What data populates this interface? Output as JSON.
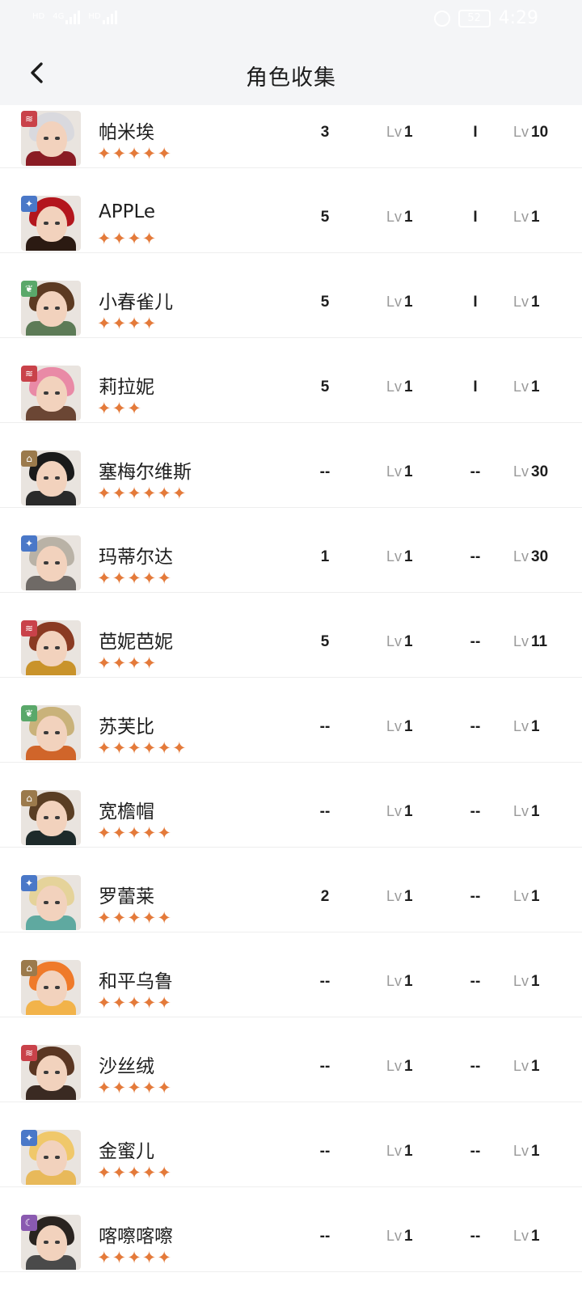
{
  "status_bar": {
    "left_tag": "HD",
    "sim1_tag": "4G",
    "sim2_tag": "HD",
    "battery": "52",
    "time": "4:29"
  },
  "header": {
    "title": "角色收集"
  },
  "characters": [
    {
      "name": "帕米埃",
      "stars": "✦✦✦✦✦",
      "col_a": "3",
      "col_b_tag": "Lv",
      "col_b": "1",
      "col_c": "I",
      "col_d_tag": "Lv",
      "col_d": "10",
      "element": "wind",
      "element_color": "#c9424a",
      "hair_color": "#d9d9de",
      "outfit_color": "#8a1c24"
    },
    {
      "name": "APPLe",
      "stars": "✦✦✦✦",
      "col_a": "5",
      "col_b_tag": "Lv",
      "col_b": "1",
      "col_c": "I",
      "col_d_tag": "Lv",
      "col_d": "1",
      "element": "star",
      "element_color": "#4a78c8",
      "hair_color": "#b3161d",
      "outfit_color": "#2b1a12"
    },
    {
      "name": "小春雀儿",
      "stars": "✦✦✦✦",
      "col_a": "5",
      "col_b_tag": "Lv",
      "col_b": "1",
      "col_c": "I",
      "col_d_tag": "Lv",
      "col_d": "1",
      "element": "leaf",
      "element_color": "#5aa86a",
      "hair_color": "#5c3a22",
      "outfit_color": "#5d7b57"
    },
    {
      "name": "莉拉妮",
      "stars": "✦✦✦",
      "col_a": "5",
      "col_b_tag": "Lv",
      "col_b": "1",
      "col_c": "I",
      "col_d_tag": "Lv",
      "col_d": "1",
      "element": "wind",
      "element_color": "#c9424a",
      "hair_color": "#e98aa6",
      "outfit_color": "#6b4634"
    },
    {
      "name": "塞梅尔维斯",
      "stars": "✦✦✦✦✦✦",
      "col_a": "--",
      "col_b_tag": "Lv",
      "col_b": "1",
      "col_c": "--",
      "col_d_tag": "Lv",
      "col_d": "30",
      "element": "rock",
      "element_color": "#9b7a4c",
      "hair_color": "#1a1a1a",
      "outfit_color": "#2a2a2a"
    },
    {
      "name": "玛蒂尔达",
      "stars": "✦✦✦✦✦",
      "col_a": "1",
      "col_b_tag": "Lv",
      "col_b": "1",
      "col_c": "--",
      "col_d_tag": "Lv",
      "col_d": "30",
      "element": "star",
      "element_color": "#4a78c8",
      "hair_color": "#b9b2a6",
      "outfit_color": "#6f6a66"
    },
    {
      "name": "芭妮芭妮",
      "stars": "✦✦✦✦",
      "col_a": "5",
      "col_b_tag": "Lv",
      "col_b": "1",
      "col_c": "--",
      "col_d_tag": "Lv",
      "col_d": "11",
      "element": "wind",
      "element_color": "#c9424a",
      "hair_color": "#8a3a22",
      "outfit_color": "#c9932b"
    },
    {
      "name": "苏芙比",
      "stars": "✦✦✦✦✦✦",
      "col_a": "--",
      "col_b_tag": "Lv",
      "col_b": "1",
      "col_c": "--",
      "col_d_tag": "Lv",
      "col_d": "1",
      "element": "leaf",
      "element_color": "#5aa86a",
      "hair_color": "#c9b27a",
      "outfit_color": "#d0652a"
    },
    {
      "name": "宽檐帽",
      "stars": "✦✦✦✦✦",
      "col_a": "--",
      "col_b_tag": "Lv",
      "col_b": "1",
      "col_c": "--",
      "col_d_tag": "Lv",
      "col_d": "1",
      "element": "rock",
      "element_color": "#9b7a4c",
      "hair_color": "#5a3e24",
      "outfit_color": "#1e2a2a"
    },
    {
      "name": "罗蕾莱",
      "stars": "✦✦✦✦✦",
      "col_a": "2",
      "col_b_tag": "Lv",
      "col_b": "1",
      "col_c": "--",
      "col_d_tag": "Lv",
      "col_d": "1",
      "element": "star",
      "element_color": "#4a78c8",
      "hair_color": "#e5d39a",
      "outfit_color": "#5fa9a0"
    },
    {
      "name": "和平乌鲁",
      "stars": "✦✦✦✦✦",
      "col_a": "--",
      "col_b_tag": "Lv",
      "col_b": "1",
      "col_c": "--",
      "col_d_tag": "Lv",
      "col_d": "1",
      "element": "rock",
      "element_color": "#9b7a4c",
      "hair_color": "#ef7a2a",
      "outfit_color": "#f2b34a"
    },
    {
      "name": "沙丝绒",
      "stars": "✦✦✦✦✦",
      "col_a": "--",
      "col_b_tag": "Lv",
      "col_b": "1",
      "col_c": "--",
      "col_d_tag": "Lv",
      "col_d": "1",
      "element": "wind",
      "element_color": "#c9424a",
      "hair_color": "#5a3622",
      "outfit_color": "#3a2a22"
    },
    {
      "name": "金蜜儿",
      "stars": "✦✦✦✦✦",
      "col_a": "--",
      "col_b_tag": "Lv",
      "col_b": "1",
      "col_c": "--",
      "col_d_tag": "Lv",
      "col_d": "1",
      "element": "star",
      "element_color": "#4a78c8",
      "hair_color": "#f0c86a",
      "outfit_color": "#e8b95a"
    },
    {
      "name": "喀嚓喀嚓",
      "stars": "✦✦✦✦✦",
      "col_a": "--",
      "col_b_tag": "Lv",
      "col_b": "1",
      "col_c": "--",
      "col_d_tag": "Lv",
      "col_d": "1",
      "element": "moon",
      "element_color": "#8a5ab0",
      "hair_color": "#2a2420",
      "outfit_color": "#4a4a4a"
    }
  ]
}
